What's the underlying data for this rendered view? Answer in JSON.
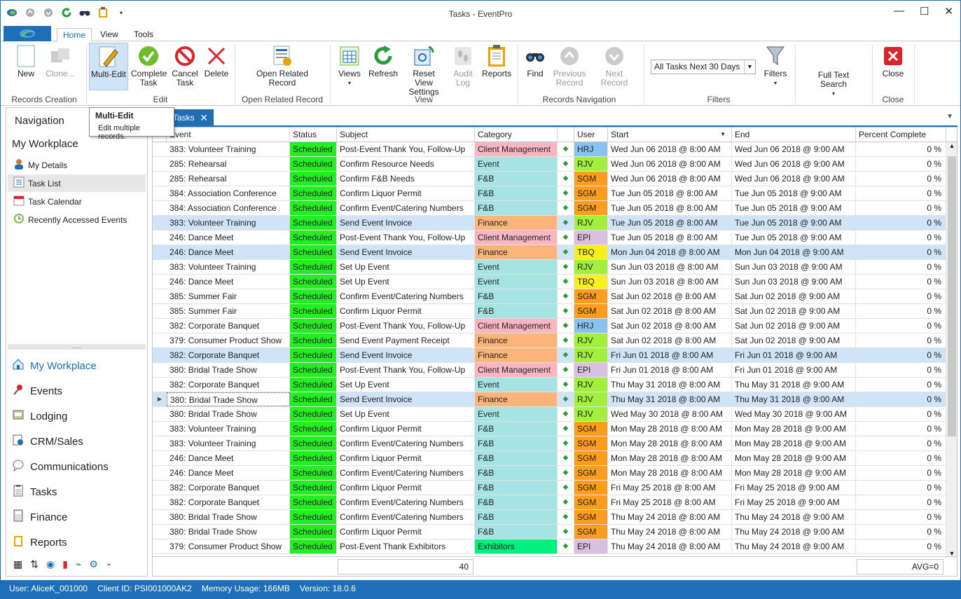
{
  "window": {
    "title": "Tasks - EventPro",
    "minimize": "—",
    "maximize": "☐",
    "close": "✕"
  },
  "ribbon_tabs": [
    "Home",
    "View",
    "Tools"
  ],
  "ribbon": {
    "new": "New",
    "clone": "Clone...",
    "multi_edit": "Multi-Edit",
    "complete_task": "Complete Task",
    "cancel_task": "Cancel Task",
    "delete": "Delete",
    "open_related_record": "Open Related Record",
    "views": "Views",
    "refresh": "Refresh",
    "reset_view_settings": "Reset View Settings",
    "audit_log": "Audit Log",
    "reports": "Reports",
    "find": "Find",
    "previous_record": "Previous Record",
    "next_record": "Next Record",
    "filter_value": "All Tasks Next 30 Days",
    "filters": "Filters",
    "full_text_search": "Full Text Search",
    "close": "Close",
    "groups": {
      "records_creation": "Records Creation",
      "edit": "Edit",
      "open_related": "Open Related Record",
      "view": "View",
      "records_navigation": "Records Navigation",
      "filters": "Filters",
      "close": "Close"
    }
  },
  "tooltip": {
    "title": "Multi-Edit",
    "text": "Edit multiple records."
  },
  "nav": {
    "header": "Navigation",
    "workplace": "My Workplace",
    "items": [
      "My Details",
      "Task List",
      "Task Calendar",
      "Recently Accessed Events"
    ],
    "modules": [
      "My Workplace",
      "Events",
      "Lodging",
      "CRM/Sales",
      "Communications",
      "Tasks",
      "Finance",
      "Reports"
    ]
  },
  "doc_tab": {
    "label": "Tasks",
    "close": "✕"
  },
  "grid": {
    "columns": [
      "Event",
      "Status",
      "Subject",
      "Category",
      "",
      "User",
      "Start",
      "End",
      "Percent Complete"
    ],
    "rows": [
      [
        "383: Volunteer Training",
        "Scheduled",
        "Post-Event Thank You, Follow-Up",
        "Client Management",
        "HRJ",
        "Wed Jun 06 2018 @ 8:00 AM",
        "Wed Jun 06 2018 @ 9:00 AM",
        "0 %"
      ],
      [
        "285: Rehearsal",
        "Scheduled",
        "Confirm Resource Needs",
        "Event",
        "RJV",
        "Wed Jun 06 2018 @ 8:00 AM",
        "Wed Jun 06 2018 @ 9:00 AM",
        "0 %"
      ],
      [
        "285: Rehearsal",
        "Scheduled",
        "Confirm F&B Needs",
        "F&B",
        "SGM",
        "Wed Jun 06 2018 @ 8:00 AM",
        "Wed Jun 06 2018 @ 9:00 AM",
        "0 %"
      ],
      [
        "384: Association Conference",
        "Scheduled",
        "Confirm Liquor Permit",
        "F&B",
        "SGM",
        "Tue Jun 05 2018 @ 8:00 AM",
        "Tue Jun 05 2018 @ 9:00 AM",
        "0 %"
      ],
      [
        "384: Association Conference",
        "Scheduled",
        "Confirm Event/Catering Numbers",
        "F&B",
        "SGM",
        "Tue Jun 05 2018 @ 8:00 AM",
        "Tue Jun 05 2018 @ 9:00 AM",
        "0 %"
      ],
      [
        "383: Volunteer Training",
        "Scheduled",
        "Send Event Invoice",
        "Finance",
        "RJV",
        "Tue Jun 05 2018 @ 8:00 AM",
        "Tue Jun 05 2018 @ 9:00 AM",
        "0 %"
      ],
      [
        "246: Dance Meet",
        "Scheduled",
        "Post-Event Thank You, Follow-Up",
        "Client Management",
        "EPI",
        "Tue Jun 05 2018 @ 8:00 AM",
        "Tue Jun 05 2018 @ 9:00 AM",
        "0 %"
      ],
      [
        "246: Dance Meet",
        "Scheduled",
        "Send Event Invoice",
        "Finance",
        "TBQ",
        "Mon Jun 04 2018 @ 8:00 AM",
        "Mon Jun 04 2018 @ 9:00 AM",
        "0 %"
      ],
      [
        "383: Volunteer Training",
        "Scheduled",
        "Set Up Event",
        "Event",
        "RJV",
        "Sun Jun 03 2018 @ 8:00 AM",
        "Sun Jun 03 2018 @ 9:00 AM",
        "0 %"
      ],
      [
        "246: Dance Meet",
        "Scheduled",
        "Set Up Event",
        "Event",
        "TBQ",
        "Sun Jun 03 2018 @ 8:00 AM",
        "Sun Jun 03 2018 @ 9:00 AM",
        "0 %"
      ],
      [
        "385: Summer Fair",
        "Scheduled",
        "Confirm Event/Catering Numbers",
        "F&B",
        "SGM",
        "Sat Jun 02 2018 @ 8:00 AM",
        "Sat Jun 02 2018 @ 9:00 AM",
        "0 %"
      ],
      [
        "385: Summer Fair",
        "Scheduled",
        "Confirm Liquor Permit",
        "F&B",
        "SGM",
        "Sat Jun 02 2018 @ 8:00 AM",
        "Sat Jun 02 2018 @ 9:00 AM",
        "0 %"
      ],
      [
        "382: Corporate Banquet",
        "Scheduled",
        "Post-Event Thank You, Follow-Up",
        "Client Management",
        "HRJ",
        "Sat Jun 02 2018 @ 8:00 AM",
        "Sat Jun 02 2018 @ 9:00 AM",
        "0 %"
      ],
      [
        "379: Consumer Product Show",
        "Scheduled",
        "Send Event Payment Receipt",
        "Finance",
        "RJV",
        "Sat Jun 02 2018 @ 8:00 AM",
        "Sat Jun 02 2018 @ 9:00 AM",
        "0 %"
      ],
      [
        "382: Corporate Banquet",
        "Scheduled",
        "Send Event Invoice",
        "Finance",
        "RJV",
        "Fri Jun 01 2018 @ 8:00 AM",
        "Fri Jun 01 2018 @ 9:00 AM",
        "0 %"
      ],
      [
        "380: Bridal Trade Show",
        "Scheduled",
        "Post-Event Thank You, Follow-Up",
        "Client Management",
        "EPI",
        "Fri Jun 01 2018 @ 8:00 AM",
        "Fri Jun 01 2018 @ 9:00 AM",
        "0 %"
      ],
      [
        "382: Corporate Banquet",
        "Scheduled",
        "Set Up Event",
        "Event",
        "RJV",
        "Thu May 31 2018 @ 8:00 AM",
        "Thu May 31 2018 @ 9:00 AM",
        "0 %"
      ],
      [
        "380: Bridal Trade Show",
        "Scheduled",
        "Send Event Invoice",
        "Finance",
        "RJV",
        "Thu May 31 2018 @ 8:00 AM",
        "Thu May 31 2018 @ 9:00 AM",
        "0 %"
      ],
      [
        "380: Bridal Trade Show",
        "Scheduled",
        "Set Up Event",
        "Event",
        "RJV",
        "Wed May 30 2018 @ 8:00 AM",
        "Wed May 30 2018 @ 9:00 AM",
        "0 %"
      ],
      [
        "383: Volunteer Training",
        "Scheduled",
        "Confirm Liquor Permit",
        "F&B",
        "SGM",
        "Mon May 28 2018 @ 8:00 AM",
        "Mon May 28 2018 @ 9:00 AM",
        "0 %"
      ],
      [
        "383: Volunteer Training",
        "Scheduled",
        "Confirm Event/Catering Numbers",
        "F&B",
        "SGM",
        "Mon May 28 2018 @ 8:00 AM",
        "Mon May 28 2018 @ 9:00 AM",
        "0 %"
      ],
      [
        "246: Dance Meet",
        "Scheduled",
        "Confirm Liquor Permit",
        "F&B",
        "SGM",
        "Mon May 28 2018 @ 8:00 AM",
        "Mon May 28 2018 @ 9:00 AM",
        "0 %"
      ],
      [
        "246: Dance Meet",
        "Scheduled",
        "Confirm Event/Catering Numbers",
        "F&B",
        "SGM",
        "Mon May 28 2018 @ 8:00 AM",
        "Mon May 28 2018 @ 9:00 AM",
        "0 %"
      ],
      [
        "382: Corporate Banquet",
        "Scheduled",
        "Confirm Liquor Permit",
        "F&B",
        "SGM",
        "Fri May 25 2018 @ 8:00 AM",
        "Fri May 25 2018 @ 9:00 AM",
        "0 %"
      ],
      [
        "382: Corporate Banquet",
        "Scheduled",
        "Confirm Event/Catering Numbers",
        "F&B",
        "SGM",
        "Fri May 25 2018 @ 8:00 AM",
        "Fri May 25 2018 @ 9:00 AM",
        "0 %"
      ],
      [
        "380: Bridal Trade Show",
        "Scheduled",
        "Confirm Event/Catering Numbers",
        "F&B",
        "SGM",
        "Thu May 24 2018 @ 8:00 AM",
        "Thu May 24 2018 @ 9:00 AM",
        "0 %"
      ],
      [
        "380: Bridal Trade Show",
        "Scheduled",
        "Confirm Liquor Permit",
        "F&B",
        "SGM",
        "Thu May 24 2018 @ 8:00 AM",
        "Thu May 24 2018 @ 9:00 AM",
        "0 %"
      ],
      [
        "379: Consumer Product Show",
        "Scheduled",
        "Post-Event Thank Exhibitors",
        "Exhibitors",
        "EPI",
        "Thu May 24 2018 @ 8:00 AM",
        "Thu May 24 2018 @ 9:00 AM",
        "0 %"
      ]
    ],
    "highlighted_rows": [
      5,
      7,
      14,
      17
    ],
    "current_row": 17,
    "footer_count": "40",
    "footer_avg": "AVG=0"
  },
  "colors": {
    "accent": "#1e6fb8",
    "status_scheduled": "#22ee22",
    "category": {
      "Client Management": "#f7b6c2",
      "Event": "#a6e4e4",
      "F&B": "#a6e4e4",
      "Finance": "#fbb57a",
      "Exhibitors": "#00f080"
    },
    "user": {
      "HRJ": "#88c3f0",
      "RJV": "#a2f03c",
      "SGM": "#ff9d1e",
      "EPI": "#d9bfe0",
      "TBQ": "#f7f01e"
    }
  },
  "status_bar": {
    "user": "User: AliceK_001000",
    "client_id": "Client ID: PSI001000AK2",
    "memory": "Memory Usage: 166MB",
    "version": "Version: 18.0.6"
  }
}
